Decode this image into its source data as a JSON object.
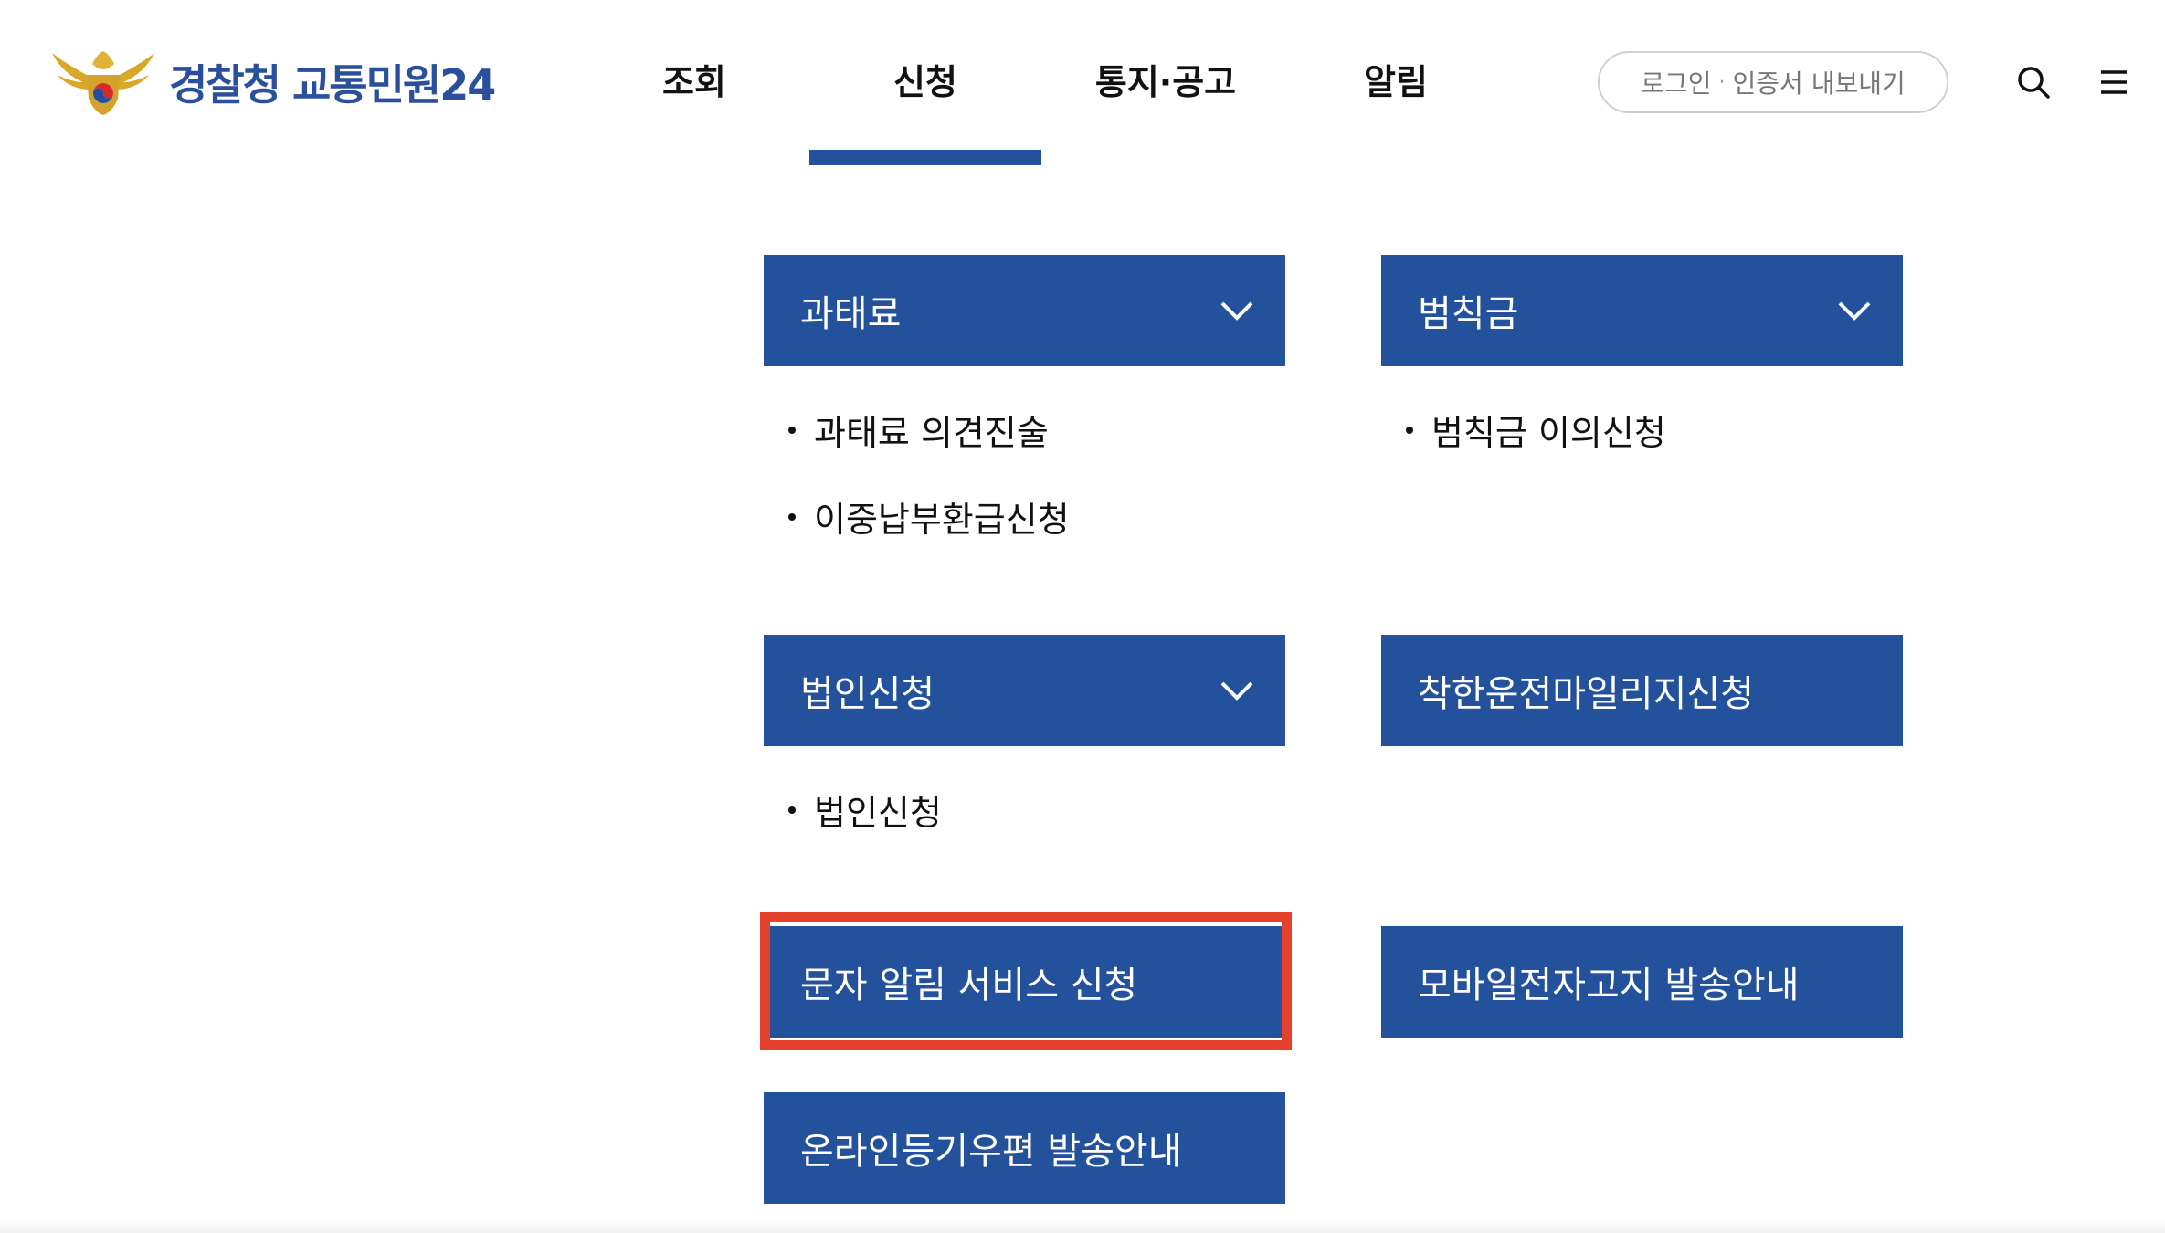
{
  "header": {
    "logo_text": "경찰청 교통민원24",
    "nav": [
      {
        "label": "조회"
      },
      {
        "label": "신청"
      },
      {
        "label": "통지·공고"
      },
      {
        "label": "알림"
      }
    ],
    "active_nav": "신청",
    "login_label": "로그인",
    "cert_export_label": "인증서 내보내기",
    "login_separator": "·"
  },
  "menu": {
    "fine": {
      "title": "과태료",
      "items": [
        "과태료 의견진술",
        "이중납부환급신청"
      ]
    },
    "penalty": {
      "title": "범칙금",
      "items": [
        "범칙금 이의신청"
      ]
    },
    "corporate": {
      "title": "법인신청",
      "items": [
        "법인신청"
      ]
    },
    "good_driving": {
      "title": "착한운전마일리지신청"
    },
    "sms_alert": {
      "title": "문자 알림 서비스 신청",
      "highlighted": true
    },
    "mobile_notice": {
      "title": "모바일전자고지 발송안내"
    },
    "registered_mail": {
      "title": "온라인등기우편 발송안내"
    }
  },
  "colors": {
    "brand_blue": "#23519c",
    "logo_blue": "#2a4f9c",
    "highlight_red": "#e5412c"
  },
  "icons": {
    "search": "search-icon",
    "menu": "hamburger-menu-icon",
    "expand": "chevron-down-icon",
    "logo": "police-emblem-icon"
  }
}
